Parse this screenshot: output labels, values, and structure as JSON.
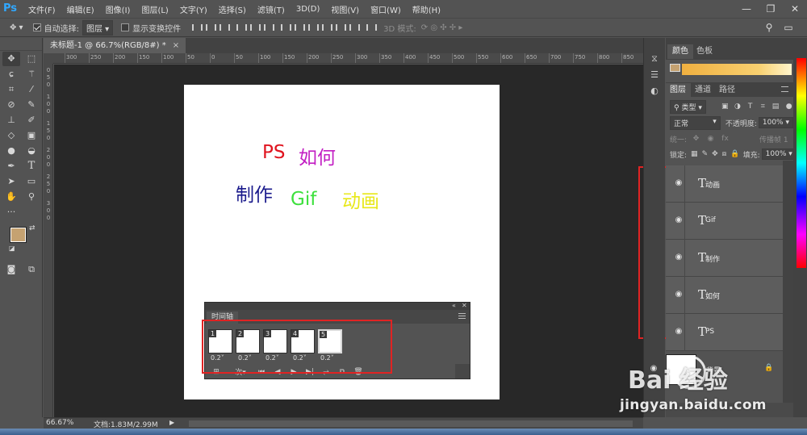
{
  "app": {
    "logo": "Ps"
  },
  "menu": [
    "文件(F)",
    "编辑(E)",
    "图像(I)",
    "图层(L)",
    "文字(Y)",
    "选择(S)",
    "滤镜(T)",
    "3D(D)",
    "视图(V)",
    "窗口(W)",
    "帮助(H)"
  ],
  "window_controls": {
    "minimize": "—",
    "maximize": "❐",
    "close": "✕"
  },
  "options": {
    "auto_select_label": "自动选择:",
    "auto_select_value": "图层",
    "show_transform_label": "显示变换控件",
    "mode_3d_label": "3D 模式:"
  },
  "document": {
    "tab_title": "未标题-1 @ 66.7%(RGB/8#) *",
    "tab_close": "×",
    "ruler_top_labels": [
      "300",
      "250",
      "200",
      "150",
      "100",
      "50",
      "0",
      "50",
      "100",
      "150",
      "200",
      "250",
      "300",
      "350",
      "400",
      "450",
      "500",
      "550",
      "600",
      "650",
      "700",
      "750",
      "800",
      "850",
      "900"
    ],
    "ruler_left_labels": [
      "0",
      "5",
      "0",
      "1",
      "0",
      "0",
      "1",
      "5",
      "0",
      "2",
      "0",
      "0",
      "2",
      "5",
      "0",
      "3",
      "0",
      "0"
    ]
  },
  "canvas_texts": [
    {
      "id": "ps",
      "text": "PS",
      "color": "#e0141f"
    },
    {
      "id": "ruhe",
      "text": "如何",
      "color": "#c21fc3"
    },
    {
      "id": "zhizuo",
      "text": "制作",
      "color": "#1a1a8c"
    },
    {
      "id": "gif",
      "text": "Gif",
      "color": "#3de03d"
    },
    {
      "id": "donghua",
      "text": "动画",
      "color": "#e8e81a"
    }
  ],
  "timeline": {
    "tab_label": "时间轴",
    "frames": [
      {
        "number": "1",
        "delay": "0.2"
      },
      {
        "number": "2",
        "delay": "0.2"
      },
      {
        "number": "3",
        "delay": "0.2"
      },
      {
        "number": "4",
        "delay": "0.2"
      },
      {
        "number": "5",
        "delay": "0.2"
      }
    ],
    "selected_frame": 5
  },
  "color_panel": {
    "tabs": [
      "颜色",
      "色板"
    ],
    "accent": "#c5a271"
  },
  "layers_panel": {
    "tabs": [
      "图层",
      "通道",
      "路径"
    ],
    "filter_label": "类型",
    "blend_mode": "正常",
    "opacity_label": "不透明度:",
    "opacity_value": "100%",
    "unify_label": "统一:",
    "propagate_label": "传播帧 1",
    "lock_label": "锁定:",
    "fill_label": "填充:",
    "fill_value": "100%",
    "layers": [
      "动画",
      "Gif",
      "制作",
      "如何",
      "PS"
    ],
    "background_layer": "背景"
  },
  "status": {
    "zoom": "66.67%",
    "doc_info": "文档:1.83M/2.99M",
    "arrow": "▶"
  },
  "watermark": {
    "logo": "Bai  经验",
    "url": "jingyan.baidu.com"
  },
  "colors": {
    "foreground": "#c5a271",
    "background": "#ffffff",
    "highlight_box": "#e02323"
  }
}
